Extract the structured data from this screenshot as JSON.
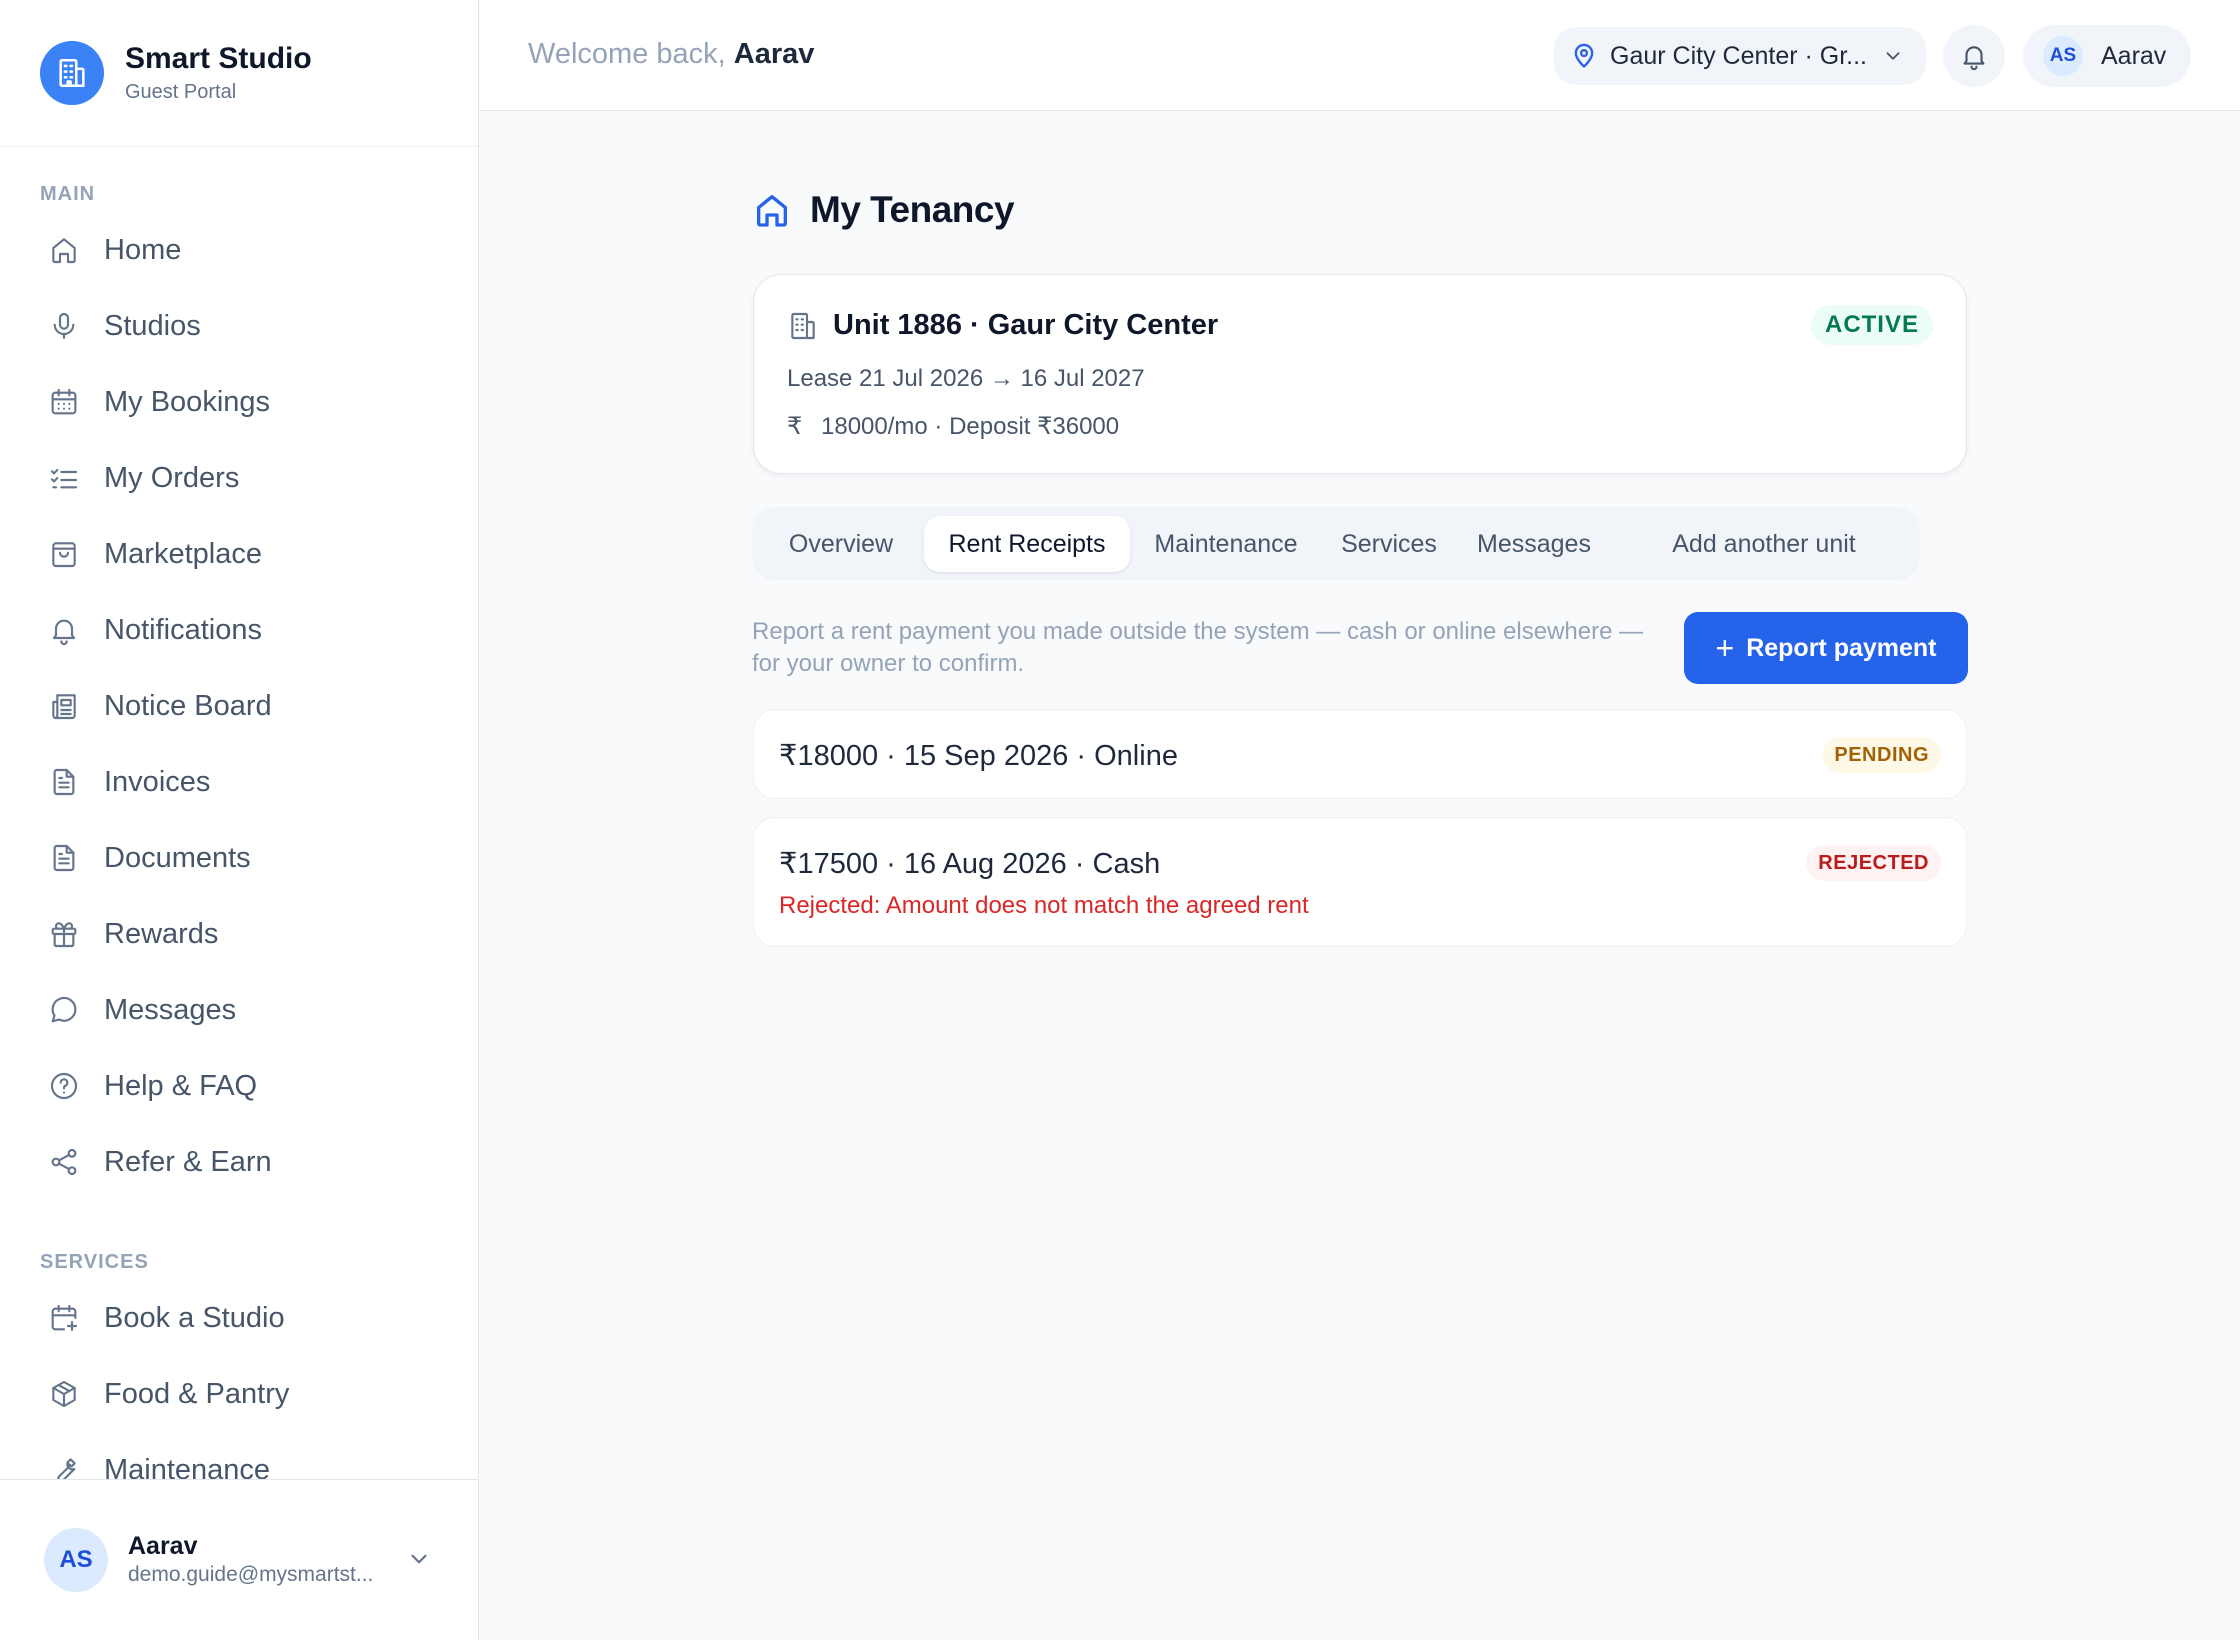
{
  "brand": {
    "title": "Smart Studio",
    "subtitle": "Guest Portal"
  },
  "sidebar": {
    "main_label": "MAIN",
    "main_items": [
      {
        "label": "Home",
        "icon": "home-icon"
      },
      {
        "label": "Studios",
        "icon": "microphone-icon"
      },
      {
        "label": "My Bookings",
        "icon": "calendar-icon"
      },
      {
        "label": "My Orders",
        "icon": "checklist-icon"
      },
      {
        "label": "Marketplace",
        "icon": "shopping-bag-icon"
      },
      {
        "label": "Notifications",
        "icon": "bell-icon"
      },
      {
        "label": "Notice Board",
        "icon": "newspaper-icon"
      },
      {
        "label": "Invoices",
        "icon": "file-text-icon"
      },
      {
        "label": "Documents",
        "icon": "document-icon"
      },
      {
        "label": "Rewards",
        "icon": "gift-icon"
      },
      {
        "label": "Messages",
        "icon": "chat-icon"
      },
      {
        "label": "Help & FAQ",
        "icon": "help-circle-icon"
      },
      {
        "label": "Refer & Earn",
        "icon": "share-icon"
      }
    ],
    "services_label": "SERVICES",
    "service_items": [
      {
        "label": "Book a Studio",
        "icon": "calendar-plus-icon"
      },
      {
        "label": "Food & Pantry",
        "icon": "package-icon"
      },
      {
        "label": "Maintenance",
        "icon": "wrench-icon"
      }
    ],
    "footer": {
      "initials": "AS",
      "name": "Aarav",
      "email": "demo.guide@mysmartst..."
    }
  },
  "header": {
    "welcome_prefix": "Welcome back,",
    "welcome_name": "Aarav",
    "location": "Gaur City Center · Gr...",
    "user_initials": "AS",
    "user_name": "Aarav"
  },
  "page": {
    "title": "My Tenancy",
    "unit": {
      "title": "Unit 1886 · Gaur City Center",
      "status": "ACTIVE",
      "lease": "Lease 21 Jul 2026 → 16 Jul 2027",
      "rupee_symbol": "₹",
      "rent": "18000/mo · Deposit ₹36000"
    },
    "tabs": [
      "Overview",
      "Rent Receipts",
      "Maintenance",
      "Services",
      "Messages",
      "Add another unit"
    ],
    "active_tab": "Rent Receipts",
    "hint": "Report a rent payment you made outside the system — cash or online elsewhere — for your owner to confirm.",
    "report_button": "Report payment",
    "receipts": [
      {
        "summary": "₹18000 · 15 Sep 2026 · Online",
        "status": "PENDING",
        "note": ""
      },
      {
        "summary": "₹17500 · 16 Aug 2026 · Cash",
        "status": "REJECTED",
        "note": "Rejected: Amount does not match the agreed rent"
      }
    ]
  },
  "colors": {
    "accent": "#2563eb",
    "brand_logo": "#3b82f6",
    "active": "#047857",
    "pending": "#a16207",
    "rejected": "#dc2626"
  }
}
